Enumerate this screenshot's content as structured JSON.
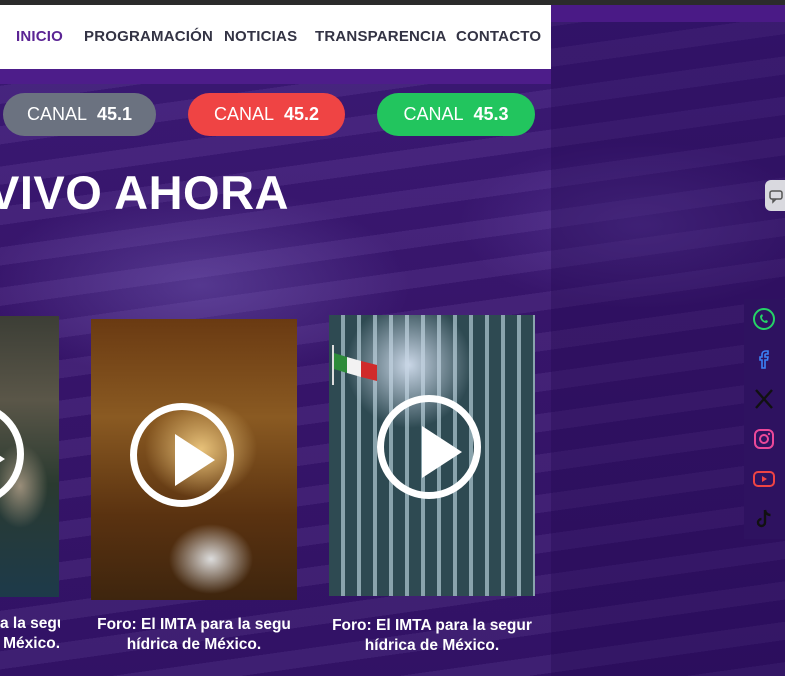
{
  "nav": {
    "items": [
      "INICIO",
      "PROGRAMACIÓN",
      "NOTICIAS",
      "TRANSPARENCIA",
      "CONTACTO"
    ],
    "active": "INICIO"
  },
  "channels": [
    {
      "label": "CANAL",
      "number": "45.1",
      "color": "#6b7280"
    },
    {
      "label": "CANAL",
      "number": "45.2",
      "color": "#ef4444"
    },
    {
      "label": "CANAL",
      "number": "45.3",
      "color": "#22c55e"
    }
  ],
  "heading": "VIVO AHORA",
  "videos": [
    {
      "caption_line1": "a la segu",
      "caption_line2": "México."
    },
    {
      "caption_line1": "Foro: El IMTA para la segu",
      "caption_line2": "hídrica de México."
    },
    {
      "caption_line1": "Foro: El IMTA para la segur",
      "caption_line2": "hídrica de México."
    }
  ],
  "social": [
    "whatsapp-icon",
    "facebook-icon",
    "x-icon",
    "instagram-icon",
    "youtube-icon",
    "tiktok-icon"
  ],
  "colors": {
    "accent": "#5b2494",
    "background": "#3a1673"
  }
}
